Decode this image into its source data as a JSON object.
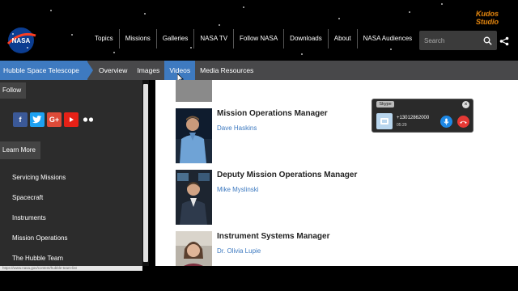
{
  "header": {
    "logo_text": "NASA",
    "nav": [
      "Topics",
      "Missions",
      "Galleries",
      "NASA TV",
      "Follow NASA",
      "Downloads",
      "About",
      "NASA Audiences"
    ],
    "search_placeholder": "Search",
    "watermark_line1": "Kudos",
    "watermark_line2": "Studio"
  },
  "subnav": {
    "section": "Hubble Space Telescope",
    "tabs": [
      "Overview",
      "Images",
      "Videos",
      "Media Resources"
    ],
    "active_tab": "Videos"
  },
  "sidebar": {
    "follow_label": "Follow",
    "social": [
      {
        "name": "facebook-icon",
        "glyph": "f",
        "color": "#3b5998"
      },
      {
        "name": "twitter-icon",
        "glyph": "t",
        "color": "#1da1f2"
      },
      {
        "name": "google-plus-icon",
        "glyph": "G+",
        "color": "#dd4b39"
      },
      {
        "name": "youtube-icon",
        "glyph": "▶",
        "color": "#e62117"
      },
      {
        "name": "flickr-icon",
        "glyph": "●●",
        "color": "transparent"
      }
    ],
    "learn_more_label": "Learn More",
    "links": [
      "Servicing Missions",
      "Spacecraft",
      "Instruments",
      "Mission Operations",
      "The Hubble Team"
    ]
  },
  "team": [
    {
      "title": "Mission Operations Manager",
      "name": "Dave Haskins"
    },
    {
      "title": "Deputy Mission Operations Manager",
      "name": "Mike Myslinski"
    },
    {
      "title": "Instrument Systems Manager",
      "name": "Dr. Olivia Lupie"
    }
  ],
  "skype": {
    "brand": "Skype",
    "number": "+13012862000",
    "duration": "05:29"
  },
  "status_url": "https://www.nasa.gov/content/hubble-team-list"
}
